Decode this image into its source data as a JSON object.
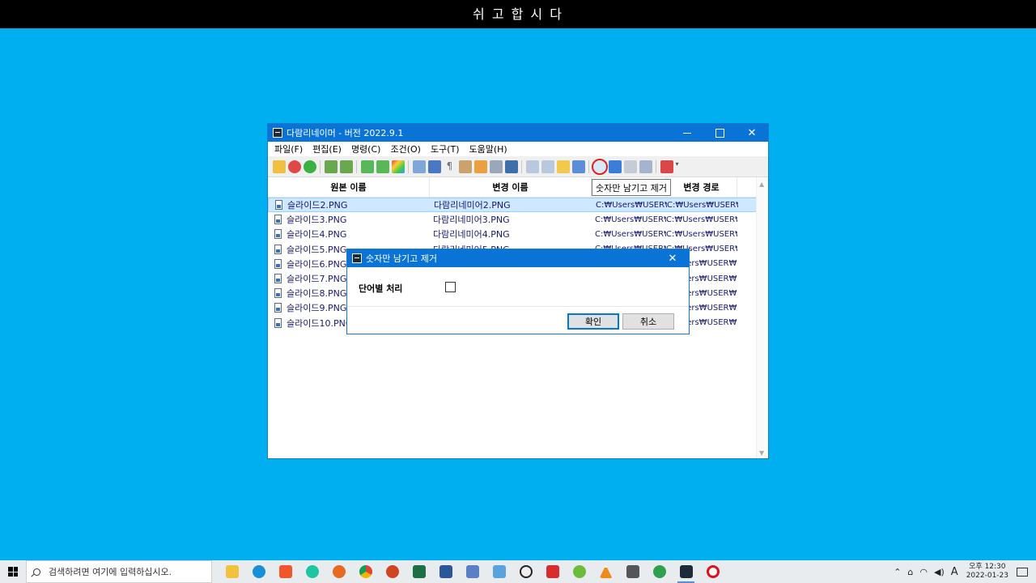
{
  "banner": {
    "text": "쉬 고 합 시 다"
  },
  "window": {
    "title": "다람리네이머 - 버전 2022.9.1",
    "menu": [
      "파일(F)",
      "편집(E)",
      "명령(C)",
      "조건(O)",
      "도구(T)",
      "도움말(H)"
    ],
    "tooltip": "숫자만 남기고 제거",
    "columns": [
      "원본 이름",
      "변경 이름",
      "",
      "변경 경로"
    ],
    "rows": [
      {
        "orig": "슬라이드2.PNG",
        "new": "다람리네미어2.PNG",
        "path": "C:₩Users₩USER₩",
        "newpath": "C:₩Users₩USER₩I"
      },
      {
        "orig": "슬라이드3.PNG",
        "new": "다람리네미어3.PNG",
        "path": "C:₩Users₩USER₩",
        "newpath": "C:₩Users₩USER₩I"
      },
      {
        "orig": "슬라이드4.PNG",
        "new": "다람리네미어4.PNG",
        "path": "C:₩Users₩USER₩",
        "newpath": "C:₩Users₩USER₩I"
      },
      {
        "orig": "슬라이드5.PNG",
        "new": "다람리네미어5.PNG",
        "path": "C:₩Users₩USER₩",
        "newpath": "C:₩Users₩USER₩I"
      },
      {
        "orig": "슬라이드6.PNG",
        "new": "",
        "path": "",
        "newpath": "sers₩USER₩I"
      },
      {
        "orig": "슬라이드7.PNG",
        "new": "",
        "path": "",
        "newpath": "sers₩USER₩I"
      },
      {
        "orig": "슬라이드8.PNG",
        "new": "",
        "path": "",
        "newpath": "sers₩USER₩I"
      },
      {
        "orig": "슬라이드9.PNG",
        "new": "",
        "path": "",
        "newpath": "sers₩USER₩I"
      },
      {
        "orig": "슬라이드10.PNG",
        "new": "",
        "path": "",
        "newpath": "sers₩USER₩I"
      }
    ]
  },
  "dialog": {
    "title": "숫자만 남기고 제거",
    "option_label": "단어별 처리",
    "ok_label": "확인",
    "cancel_label": "취소"
  },
  "taskbar": {
    "search_placeholder": "검색하려면 여기에 입력하십시오.",
    "ime": "A",
    "time_ampm": "오후 12:30",
    "date": "2022-01-23"
  },
  "colors": {
    "desktop": "#00aff0",
    "titlebar": "#0a74d6",
    "selected_row": "#cde8ff"
  }
}
